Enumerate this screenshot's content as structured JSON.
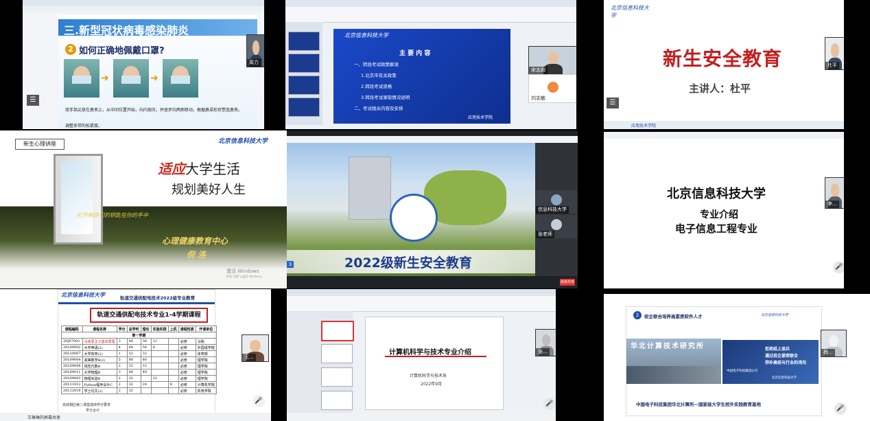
{
  "p1": {
    "title": "三.新型冠状病毒感染肺炎",
    "question_num": "2",
    "question": "如何正确地佩戴口罩?",
    "line1": "双手指尖放在鼻夹上，从中间位置开始，向内按压，并逐步向两侧移动，根据鼻梁形状塑造鼻夹。",
    "line2": "调整系带的松紧度。",
    "cam_name": "周力"
  },
  "p2": {
    "logo": "北京信息科技大学",
    "heading": "主 要 内 容",
    "items": [
      "一、转段考试政策解读",
      "1.北京市有关政策",
      "2.转段考试资格",
      "3.转段考试录取情况说明",
      "二、考试相关内容及安排"
    ],
    "footer_logo": "应用技术学院",
    "cam1_name": "宋志刚",
    "cam2_name": "刘志敏"
  },
  "p3": {
    "title": "新生安全教育",
    "speaker": "主讲人：杜平",
    "footer": "应用技术学院",
    "cam_name": "杜平"
  },
  "p4": {
    "tag": "新生心理讲座",
    "logo": "北京信息科技大学",
    "title_red": "适应",
    "title_rest": "大学生活",
    "subtitle": "规划美好人生",
    "door_text": "打开新房门的钥匙在你的手中",
    "center": "心理健康教育中心",
    "speaker": "倪 洛",
    "watermark1": "激活 Windows",
    "watermark2": "转到\"设置\"以激活 Windows。"
  },
  "p5": {
    "banner": "2022级新生安全教育",
    "cam1_name": "信息科技大学",
    "cam2_name": "张老师",
    "cam_badge": "3",
    "end_label": "结束共享"
  },
  "p6": {
    "university": "北京信息科技大学",
    "line1": "专业介绍",
    "line2": "电子信息工程专业",
    "cam_name": "李..."
  },
  "p7": {
    "logo": "北京信息科技大学",
    "header": "轨道交通供配电技术2022级专业教育",
    "box_title": "轨道交通供配电技术专业1-4学期课程",
    "term": "第一学期",
    "col_headers": [
      "课程编码",
      "课程名称",
      "学分",
      "总学时",
      "理论",
      "实验实践",
      "上机",
      "课程性质",
      "开课单位"
    ],
    "rows": [
      [
        "20J07002",
        "马克思主义基本原理",
        "3",
        "48",
        "36",
        "12",
        "",
        "必修",
        "马院"
      ],
      [
        "20L09002",
        "大学英语(2)",
        "4",
        "64",
        "56",
        "8",
        "",
        "必修",
        "外国语学院"
      ],
      [
        "20L10007",
        "大学体育(2)",
        "1",
        "32",
        "32",
        "",
        "",
        "必修",
        "体育部"
      ],
      [
        "20L09004",
        "高等数学B(2)",
        "5",
        "80",
        "80",
        "",
        "",
        "必修",
        "理学院"
      ],
      [
        "20L09008",
        "线性代数B",
        "2",
        "32",
        "32",
        "",
        "",
        "必修",
        "理学院"
      ],
      [
        "20L09011",
        "大学物理B",
        "3",
        "48",
        "48",
        "",
        "",
        "必修",
        "理学院"
      ],
      [
        "20L09003",
        "物理实验B",
        "2",
        "32",
        "",
        "32",
        "",
        "必修",
        "理学院"
      ],
      [
        "20L11012",
        "Python程序设计C",
        "2",
        "32",
        "24",
        "",
        "8",
        "必修",
        "计算机学院"
      ],
      [
        "20L12018",
        "学士论文(2)",
        "2",
        "32",
        "",
        "",
        "",
        "必修",
        "机电学院"
      ]
    ],
    "footer1": "完成相应第二课堂成绩学分要求",
    "footer2": "学分合计",
    "cam_name": "王...",
    "taskbar_name": "王琳琳的屏幕共享"
  },
  "p8": {
    "slide_title": "计算机科学与技术专业介绍",
    "dept": "计算机科学与技术系",
    "date": "2022年9月",
    "cam_name": "张..."
  },
  "p9": {
    "section_num": "2",
    "section_title": "校企联合培养高素质软件人才",
    "building_sign": "华北计算技术研究所",
    "lines": [
      "拒绝纸上谈兵",
      "通过校企紧密联合",
      "弥补高校与行业的鸿沟"
    ],
    "partner1": "中国电子科技集团公司",
    "partner2": "北京信息科技大学",
    "bottom": "中国电子科技集团华北计算所—国家级大学生校外实践教育基地",
    "cam_name": "杨..."
  },
  "icons": {
    "mic": "🎤",
    "camera": "▣",
    "menu": "☰"
  }
}
